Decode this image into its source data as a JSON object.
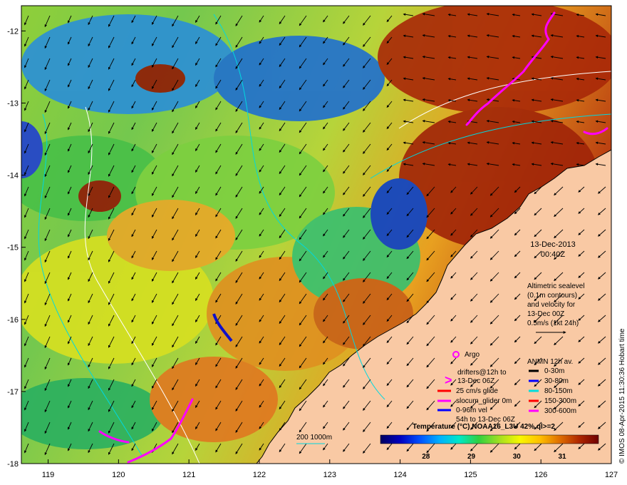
{
  "map": {
    "lon_ticks": [
      119,
      120,
      121,
      122,
      123,
      124,
      125,
      126,
      127
    ],
    "lat_ticks": [
      -12,
      -13,
      -14,
      -15,
      -16,
      -17,
      -18
    ],
    "lon_range": [
      118.62,
      127.0
    ],
    "lat_range": [
      -18.0,
      -11.65
    ],
    "land_color": "#f9c9a4",
    "coast_color": "#000000"
  },
  "datetime": {
    "date": "13-Dec-2013",
    "time": "00:40Z"
  },
  "altimetry": {
    "lines": [
      "Altimetric sealevel",
      "(0.1m contours)",
      "and velocity for",
      "13-Dec 00Z",
      "0.5m/s (1kt 24h)"
    ]
  },
  "legend_left": {
    "argo": "Argo",
    "drifters_line1": "drifters@12h to",
    "drifters_line2": "13-Dec 06Z",
    "glide": "25 cm/s glide",
    "slocum": "slocum_glider 0m",
    "vel_line1": "0-96m vel",
    "vel_line2": "54h to 13-Dec 06Z",
    "argo_color": "#ff00ff",
    "drifter_color": "#ff00ff",
    "glide_color": "#ff0000",
    "slocum_color": "#ff00ff",
    "vel_color": "#0000ff"
  },
  "legend_anmn": {
    "title": "ANMN 12h av.",
    "items": [
      {
        "label": "0-30m",
        "color": "#000000"
      },
      {
        "label": "30-80m",
        "color": "#0000ff"
      },
      {
        "label": "80-150m",
        "color": "#00dddd"
      },
      {
        "label": "150-300m",
        "color": "#ff0000"
      },
      {
        "label": "300-600m",
        "color": "#ff00ff"
      }
    ]
  },
  "scale_label": "200  1000m",
  "colorbar": {
    "title": "Temperature (°C) NOAA16_L3U 42% ql>=2",
    "ticks": [
      "28",
      "29",
      "30",
      "31"
    ],
    "tick_values": [
      28,
      29,
      30,
      31
    ],
    "range": [
      27.0,
      31.8
    ],
    "colors": [
      "#000060",
      "#0000c0",
      "#0050ff",
      "#00b0ff",
      "#00e8c8",
      "#30d040",
      "#a8e020",
      "#f8f800",
      "#ffc000",
      "#e07000",
      "#b02800",
      "#700000"
    ]
  },
  "credit": "© IMOS 08-Apr-2015 11:30:36 Hobart time"
}
